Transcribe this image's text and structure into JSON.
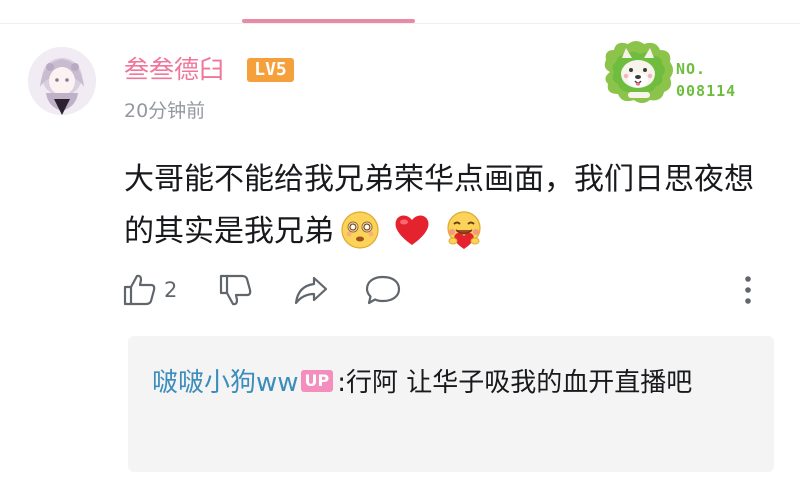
{
  "comment": {
    "username": "叁叁德臼",
    "level_badge": "LV5",
    "timestamp": "20分钟前",
    "fan_badge": {
      "label": "NO.",
      "number": "008114",
      "color": "#6ebd3f"
    },
    "text_part1": "大哥能不能给我兄弟荣华点画面，我们日思夜想的其实是我兄弟",
    "emojis": [
      "dizzy-face-emoji",
      "red-heart-emoji",
      "hugging-heart-face-emoji"
    ],
    "like_count": "2"
  },
  "reply": {
    "username": "啵啵小狗ww",
    "up_badge": "UP",
    "separator": ":",
    "text": "行阿  让华子吸我的血开直播吧"
  },
  "colors": {
    "username": "#f0769b",
    "level_badge": "#f6a03c",
    "reply_user": "#3c8dbc",
    "up_badge": "#f38ebd",
    "tab_indicator": "#e98ba6"
  }
}
